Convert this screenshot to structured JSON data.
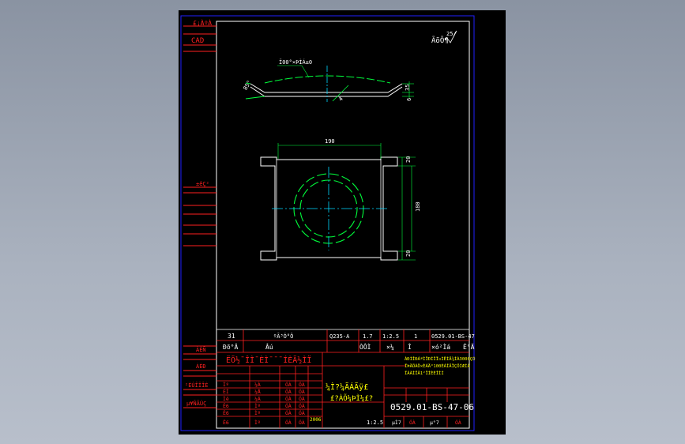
{
  "colors": {
    "background": "#000000",
    "frame_blue": "#2020ff",
    "border_white": "#ffffff",
    "red_lines": "#ff2020",
    "green_dims": "#00ff3c",
    "cyan_center": "#00d8ff",
    "yellow_text": "#ffff00"
  },
  "left_panel": {
    "top_label": "£¡ÀºÀ",
    "cad_label": "CAD",
    "mid_label": "±êÇ²",
    "rows": [
      {
        "label": "ÀÈÑ"
      },
      {
        "label": "ÀÈÐ"
      },
      {
        "label": "²ÉÚÎÏÎÈ"
      },
      {
        "label": "µ¥ÑÃÚÇ"
      }
    ]
  },
  "drawing": {
    "surface_mark": "25/",
    "surface_symbol": "ÃõÕ¶",
    "note": "Ï00°×ÞÌÁ±0",
    "dims": {
      "angle": "85°",
      "height_35": "35",
      "height_6": "6",
      "width_190": "190",
      "height_180": "180",
      "slot_top": "20",
      "slot_bottom": "20",
      "thickness": "4"
    }
  },
  "title_block": {
    "row1": {
      "c1": "31",
      "c2": "ºÃ³Ó°Ô",
      "c3": "Q235-A",
      "c4": "1.7",
      "c5": "1:2.5",
      "c6": "1",
      "c7": "0529.01-BS-47"
    },
    "row2": {
      "c1": "Ðõ°Â",
      "c2": "Âú",
      "c3": "ÒÔÌ",
      "c4": "×¼",
      "c5": "Î",
      "c6": "×ó²Ìá",
      "c7": "Ê°Ä"
    },
    "banner": "ËÕ½¯ÎÌ¯ÈÌ¯¯¯ÍÈÃ½ÌÏ",
    "note_lines": [
      "ÀÐÌÎÐÁªÌÏÐÍÎÏ¤ÌËÍÄ¾ÌÀ3000ÇÓ",
      "ÏÞÄÖÁÖ×ÈÁÄ°100ÈÁÎÄÏÇÖÍÆÍÁ",
      "ÏÃÃÌÏÂ1²ÏÌÈÈÎÌÍ"
    ],
    "part_name_1": "¼Ì?¼ÃÁÃÿ£",
    "part_name_2": "£?ÀÕ¼ÞÌ¼£?",
    "drawing_number": "0529.01-BS-47-06",
    "scale": "1:2.5",
    "year": "2006",
    "sign_rows": [
      {
        "a": "Ìº",
        "b": "¼À",
        "c": "ÓÀ",
        "d": "ÓÀ"
      },
      {
        "a": "ÈÎ",
        "b": "¼Å",
        "c": "ÓÀ",
        "d": "ÓÀ"
      },
      {
        "a": "Ìê",
        "b": "¼Á",
        "c": "ÓÀ",
        "d": "ÓÀ"
      },
      {
        "a": "Ê6",
        "b": "Ìº",
        "c": "ÓÀ",
        "d": "ÓÀ"
      },
      {
        "a": "Ê6",
        "b": "Ìº",
        "c": "ÓÀ",
        "d": "ÓÀ"
      },
      {
        "a": "Ê6",
        "b": "Ìº",
        "c": "ÓÀ",
        "d": "ÓÀ"
      }
    ],
    "bottom_cells": [
      "µÌ7",
      "ÓÀ",
      "µ°7",
      "ÓÀ"
    ]
  }
}
